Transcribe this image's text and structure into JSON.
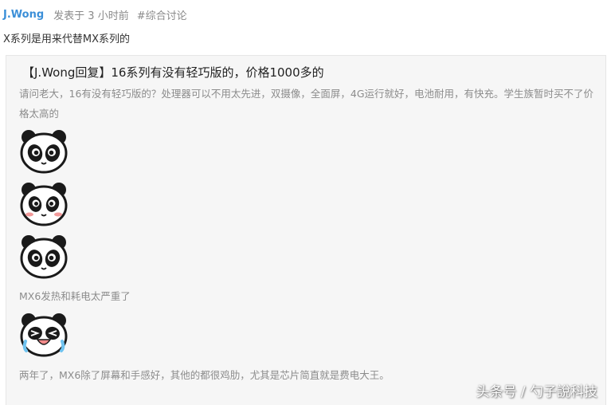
{
  "post": {
    "author": "J.Wong",
    "posted_time": "发表于 3 小时前",
    "tag": "#综合讨论",
    "text": "X系列是用来代替MX系列的"
  },
  "quote": {
    "title": "【J.Wong回复】16系列有没有轻巧版的，价格1000多的",
    "body": "请问老大，16有没有轻巧版的？处理器可以不用太先进，双摄像，全面屏，4G运行就好，电池耐用，有快充。学生族暂时买不了价格太高的",
    "emojis": [
      "panda-smile-icon",
      "panda-blush-icon",
      "panda-smile-icon",
      "panda-laugh-cry-icon"
    ],
    "line_mx6": "MX6发热和耗电太严重了",
    "line_two_years": "两年了，MX6除了屏幕和手感好，其他的都很鸡肋，尤其是芯片简直就是费电大王。"
  },
  "watermark": "头条号 / 勺子說科技",
  "colors": {
    "author": "#3b8fd8",
    "meta": "#8a8a8a",
    "quote_background": "#f6f6f6",
    "quote_text": "#8c8c8c"
  }
}
